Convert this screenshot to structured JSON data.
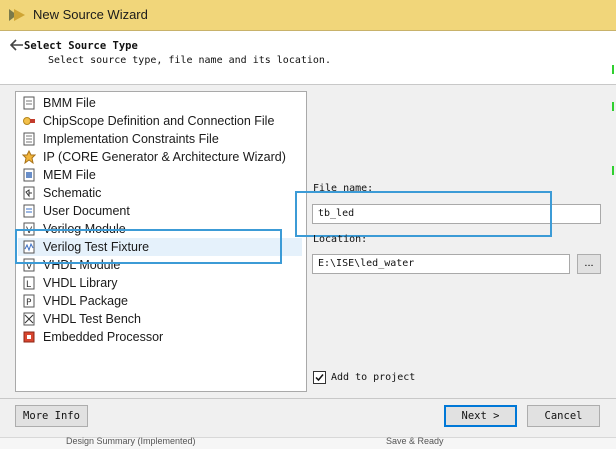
{
  "window": {
    "title": "New Source Wizard",
    "accent": "#f1d67a"
  },
  "header": {
    "title": "Select Source Type",
    "subtitle": "Select source type, file name and its location."
  },
  "source_types": [
    {
      "label": "BMM File",
      "icon": "bmm-file-icon"
    },
    {
      "label": "ChipScope Definition and Connection File",
      "icon": "chipscope-icon"
    },
    {
      "label": "Implementation Constraints File",
      "icon": "constraints-file-icon"
    },
    {
      "label": "IP (CORE Generator & Architecture Wizard)",
      "icon": "ip-core-icon"
    },
    {
      "label": "MEM File",
      "icon": "mem-file-icon"
    },
    {
      "label": "Schematic",
      "icon": "schematic-icon"
    },
    {
      "label": "User Document",
      "icon": "user-document-icon"
    },
    {
      "label": "Verilog Module",
      "icon": "verilog-module-icon"
    },
    {
      "label": "Verilog Test Fixture",
      "icon": "verilog-test-fixture-icon",
      "selected": true
    },
    {
      "label": "VHDL Module",
      "icon": "vhdl-module-icon"
    },
    {
      "label": "VHDL Library",
      "icon": "vhdl-library-icon"
    },
    {
      "label": "VHDL Package",
      "icon": "vhdl-package-icon"
    },
    {
      "label": "VHDL Test Bench",
      "icon": "vhdl-test-bench-icon"
    },
    {
      "label": "Embedded Processor",
      "icon": "embedded-processor-icon"
    }
  ],
  "form": {
    "file_name_label": "File name:",
    "file_name_value": "tb_led",
    "location_label": "Location:",
    "location_value": "E:\\ISE\\led_water",
    "browse_label": "...",
    "add_to_project_label": "Add to project",
    "add_to_project_checked": true
  },
  "buttons": {
    "more_info": "More Info",
    "next": "Next >",
    "cancel": "Cancel"
  },
  "taskbar": {
    "items": [
      "Design Summary (Implemented)",
      "Save & Ready"
    ]
  },
  "highlight_color": "#3c9bd6"
}
